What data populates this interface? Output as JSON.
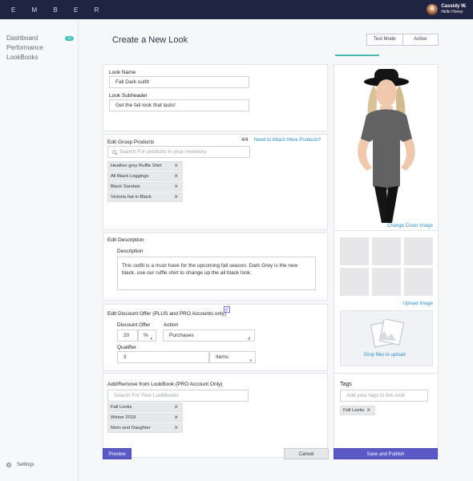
{
  "app": {
    "logo": "E M B E R",
    "user_name": "Cassidy W.",
    "user_subtitle": "Hello Honey"
  },
  "sidebar": {
    "items": [
      {
        "label": "Dashboard",
        "badge": "42"
      },
      {
        "label": "Performance"
      },
      {
        "label": "LookBooks"
      }
    ],
    "settings": "Settings"
  },
  "page": {
    "title": "Create a New Look",
    "modes": [
      "Test Mode",
      "Active"
    ]
  },
  "look": {
    "name_label": "Look Name",
    "name_value": "Fall Dark outfit",
    "subheader_label": "Look Subheader",
    "subheader_value": "Get the fall look that lasts!"
  },
  "products": {
    "title": "Edit Group Products",
    "count": "4/4",
    "attach_link": "Need to Attach More Products?",
    "search_placeholder": "Search For products in your inventory",
    "items": [
      "Heather grey Ruffle Shirt",
      "All Black Leggings",
      "Black Sandals",
      "Victoria hat in Black"
    ]
  },
  "description": {
    "title": "Edit Description",
    "label": "Description",
    "value": "This outfit is a must have for the upcoming fall season. Dark Grey is the new black, use our ruffle shirt to change up the all black look."
  },
  "discount": {
    "title": "Edit Discount Offer (PLUS and PRO Accounts only)",
    "checked": "✓",
    "offer_label": "Discount Offer",
    "offer_value": "20",
    "offer_unit": "%",
    "action_label": "Action",
    "action_value": "Purchases",
    "qualifier_label": "Qualifier",
    "qualifier_value": "3",
    "qualifier_unit": "Items"
  },
  "lookbook": {
    "title": "Add/Remove from LookBook (PRO Account Only)",
    "search_placeholder": "Search For Your LookBooks",
    "items": [
      "Fall Looks",
      "Winter 2018",
      "Mom and Daughter"
    ]
  },
  "cover": {
    "change_label": "Change Cover Image"
  },
  "gallery": {
    "upload_label": "Upload Image",
    "drop_label": "Drop files to upload"
  },
  "tags": {
    "title": "Tags",
    "placeholder": "Add your tags to this look",
    "items": [
      "Fall Looks"
    ]
  },
  "actions": {
    "preview": "Preview",
    "cancel": "Cancel",
    "save": "Save and Publish"
  },
  "colors": {
    "accent": "#5b59c6",
    "teal": "#46bab3",
    "navy": "#1f2442",
    "link": "#2c8cc7"
  }
}
